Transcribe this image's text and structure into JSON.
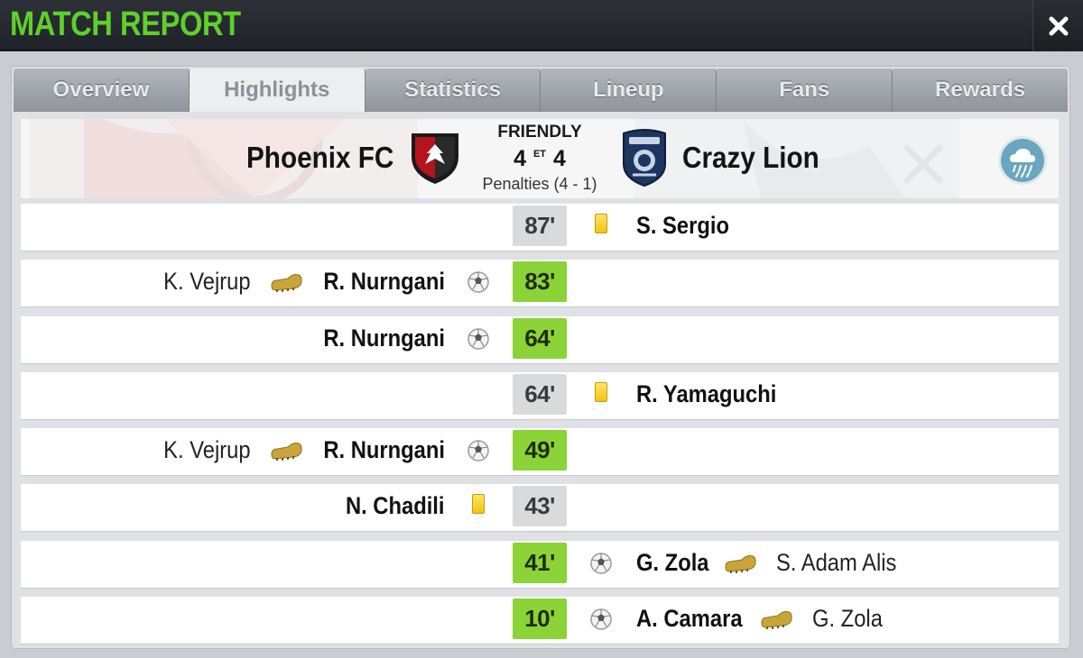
{
  "window": {
    "title": "MATCH REPORT",
    "close_icon": "close-icon"
  },
  "tabs": [
    {
      "label": "Overview",
      "active": false
    },
    {
      "label": "Highlights",
      "active": true
    },
    {
      "label": "Statistics",
      "active": false
    },
    {
      "label": "Lineup",
      "active": false
    },
    {
      "label": "Fans",
      "active": false
    },
    {
      "label": "Rewards",
      "active": false
    }
  ],
  "match": {
    "type": "FRIENDLY",
    "home_team": "Phoenix FC",
    "away_team": "Crazy Lion",
    "home_score": "4",
    "away_score": "4",
    "et_label": "ET",
    "penalties": "Penalties (4 - 1)",
    "weather_icon": "rain-cloud-icon"
  },
  "events": [
    {
      "minute": "87'",
      "kind": "yellow-card",
      "side": "away",
      "player": "S. Sergio",
      "assist": ""
    },
    {
      "minute": "83'",
      "kind": "goal",
      "side": "home",
      "player": "R. Nurngani",
      "assist": "K. Vejrup"
    },
    {
      "minute": "64'",
      "kind": "goal",
      "side": "home",
      "player": "R. Nurngani",
      "assist": ""
    },
    {
      "minute": "64'",
      "kind": "yellow-card",
      "side": "away",
      "player": "R. Yamaguchi",
      "assist": ""
    },
    {
      "minute": "49'",
      "kind": "goal",
      "side": "home",
      "player": "R. Nurngani",
      "assist": "K. Vejrup"
    },
    {
      "minute": "43'",
      "kind": "yellow-card",
      "side": "home",
      "player": "N. Chadili",
      "assist": ""
    },
    {
      "minute": "41'",
      "kind": "goal",
      "side": "away",
      "player": "G. Zola",
      "assist": "S. Adam Alis"
    },
    {
      "minute": "10'",
      "kind": "goal",
      "side": "away",
      "player": "A. Camara",
      "assist": "G. Zola"
    }
  ],
  "colors": {
    "title_green": "#5fcf2c",
    "goal_minute_bg": "#8bd337",
    "card_minute_bg": "#d9dadb",
    "yellow_card": "#f3c313"
  }
}
